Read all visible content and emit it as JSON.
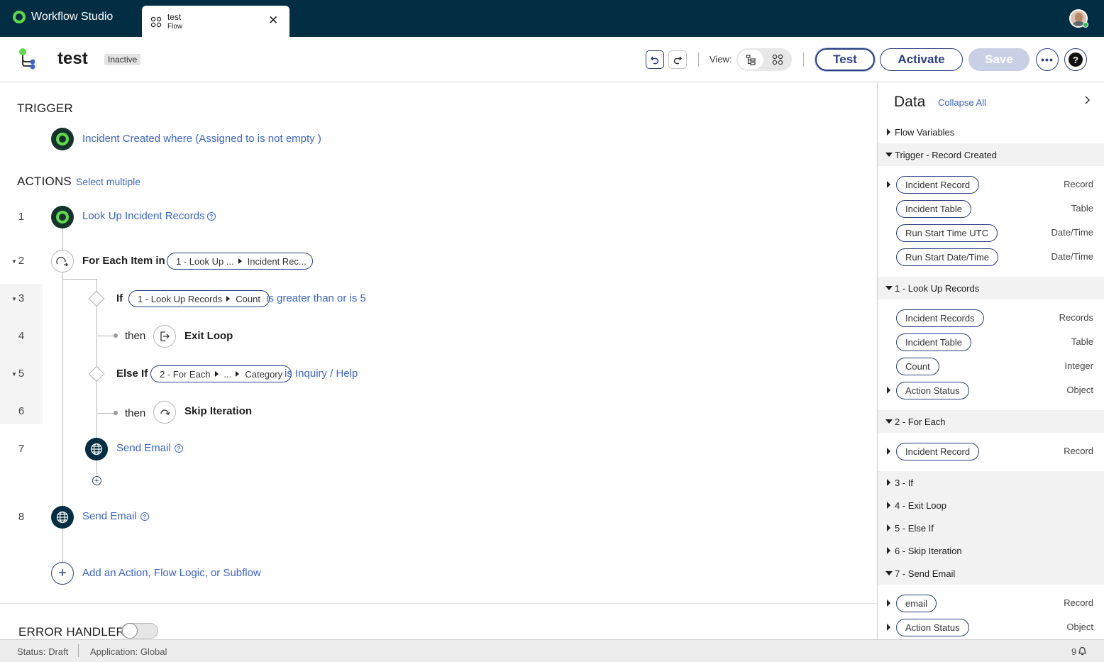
{
  "app": {
    "name": "Workflow Studio",
    "brand_color": "#032d42",
    "accent": "#62d84e",
    "link_color": "#3b64c8"
  },
  "tab": {
    "name": "test",
    "type": "Flow"
  },
  "header": {
    "title": "test",
    "status": "Inactive",
    "view_label": "View:",
    "test_label": "Test",
    "activate_label": "Activate",
    "save_label": "Save",
    "more_label": "•••",
    "help_label": "?"
  },
  "trigger": {
    "heading": "TRIGGER",
    "text": "Incident Created where (Assigned to is not empty )"
  },
  "actions": {
    "heading": "ACTIONS",
    "select_multiple": "Select multiple",
    "rows": [
      {
        "num": "1",
        "label": "Look Up Incident Records"
      },
      {
        "num": "2",
        "label": "For Each Item in",
        "pill_a": "1 - Look Up ...",
        "pill_b": "Incident Rec..."
      },
      {
        "num": "3",
        "label": "If",
        "pill_a": "1 - Look Up Records",
        "pill_b": "Count",
        "condition": "is greater than or is 5"
      },
      {
        "num": "4",
        "then": "then",
        "label": "Exit Loop"
      },
      {
        "num": "5",
        "label": "Else If",
        "pill_a": "2 - For Each",
        "pill_mid": "...",
        "pill_b": "Category",
        "condition": "is Inquiry / Help"
      },
      {
        "num": "6",
        "then": "then",
        "label": "Skip Iteration"
      },
      {
        "num": "7",
        "label": "Send Email"
      },
      {
        "num": "8",
        "label": "Send Email"
      }
    ],
    "add_label": "Add an Action, Flow Logic, or Subflow"
  },
  "error_handler": {
    "label": "ERROR HANDLER",
    "enabled": false
  },
  "data_panel": {
    "title": "Data",
    "collapse_all": "Collapse All",
    "sections": [
      {
        "label": "Flow Variables",
        "expanded": false
      },
      {
        "label": "Trigger - Record Created",
        "expanded": true,
        "items": [
          {
            "label": "Incident Record",
            "type": "Record",
            "expandable": true
          },
          {
            "label": "Incident Table",
            "type": "Table",
            "expandable": false
          },
          {
            "label": "Run Start Time UTC",
            "type": "Date/Time",
            "expandable": false
          },
          {
            "label": "Run Start Date/Time",
            "type": "Date/Time",
            "expandable": false
          }
        ]
      },
      {
        "label": "1 - Look Up Records",
        "expanded": true,
        "items": [
          {
            "label": "Incident Records",
            "type": "Records",
            "expandable": false
          },
          {
            "label": "Incident Table",
            "type": "Table",
            "expandable": false
          },
          {
            "label": "Count",
            "type": "Integer",
            "expandable": false
          },
          {
            "label": "Action Status",
            "type": "Object",
            "expandable": true
          }
        ]
      },
      {
        "label": "2 - For Each",
        "expanded": true,
        "items": [
          {
            "label": "Incident Record",
            "type": "Record",
            "expandable": true
          }
        ]
      },
      {
        "label": "3 - If",
        "expanded": false
      },
      {
        "label": "4 - Exit Loop",
        "expanded": false
      },
      {
        "label": "5 - Else If",
        "expanded": false
      },
      {
        "label": "6 - Skip Iteration",
        "expanded": false
      },
      {
        "label": "7 - Send Email",
        "expanded": true,
        "items": [
          {
            "label": "email",
            "type": "Record",
            "expandable": true
          },
          {
            "label": "Action Status",
            "type": "Object",
            "expandable": true
          }
        ]
      }
    ]
  },
  "statusbar": {
    "status": "Status: Draft",
    "application": "Application: Global",
    "notifications": "9"
  }
}
